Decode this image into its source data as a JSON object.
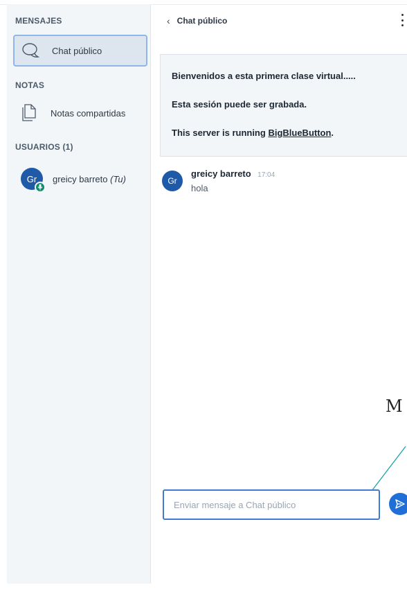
{
  "sidebar": {
    "messages_title": "MENSAJES",
    "public_chat": "Chat público",
    "notes_title": "NOTAS",
    "shared_notes": "Notas compartidas",
    "users_title": "USUARIOS (1)",
    "user": {
      "initials": "Gr",
      "name": "greicy barreto",
      "you_label": "(Tu)"
    }
  },
  "chat": {
    "header_title": "Chat público",
    "welcome": {
      "line1": "Bienvenidos a esta primera clase virtual.....",
      "line2": "Esta sesión puede ser grabada.",
      "line3_prefix": "This server is running ",
      "line3_link": "BigBlueButton",
      "line3_suffix": "."
    },
    "message": {
      "initials": "Gr",
      "author": "greicy barreto",
      "time": "17:04",
      "text": "hola"
    },
    "input_placeholder": "Enviar mensaje a Chat público"
  },
  "annotation": {
    "letter": "M",
    "line_color": "#1aa3a8"
  },
  "colors": {
    "accent": "#1f6fd6",
    "avatar": "#1f5aa8",
    "mic_badge": "#0f8b6d"
  }
}
